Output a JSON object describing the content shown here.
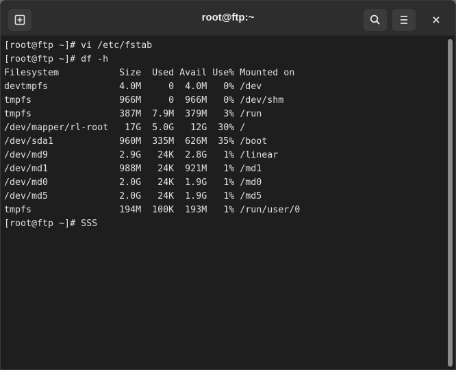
{
  "window": {
    "title": "root@ftp:~"
  },
  "header": {
    "new_tab_icon": "new-tab-icon",
    "search_icon": "search-icon",
    "menu_icon": "hamburger-menu-icon",
    "close_icon": "close-icon"
  },
  "terminal": {
    "lines": [
      "[root@ftp ~]# vi /etc/fstab",
      "[root@ftp ~]# df -h",
      "Filesystem           Size  Used Avail Use% Mounted on",
      "devtmpfs             4.0M     0  4.0M   0% /dev",
      "tmpfs                966M     0  966M   0% /dev/shm",
      "tmpfs                387M  7.9M  379M   3% /run",
      "/dev/mapper/rl-root   17G  5.0G   12G  30% /",
      "/dev/sda1            960M  335M  626M  35% /boot",
      "/dev/md9             2.9G   24K  2.8G   1% /linear",
      "/dev/md1             988M   24K  921M   1% /md1",
      "/dev/md0             2.0G   24K  1.9G   1% /md0",
      "/dev/md5             2.0G   24K  1.9G   1% /md5",
      "tmpfs                194M  100K  193M   1% /run/user/0",
      "[root@ftp ~]# SSS"
    ]
  },
  "colors": {
    "terminal_bg": "#1e1e1e",
    "terminal_fg": "#e0e0e0",
    "titlebar_bg": "#2d2d2d"
  }
}
